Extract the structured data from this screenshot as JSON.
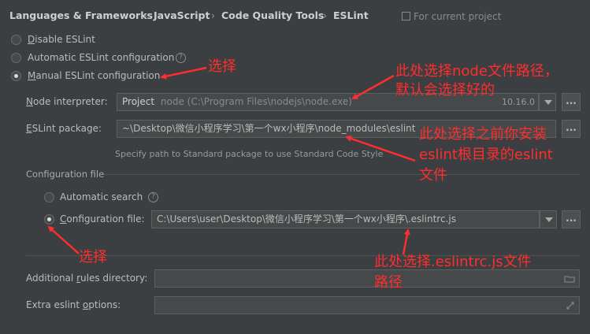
{
  "breadcrumb": {
    "items": [
      "Languages & Frameworks",
      "JavaScript",
      "Code Quality Tools",
      "ESLint"
    ],
    "separator": "›",
    "scope_label": "For current project"
  },
  "radios": {
    "disable": {
      "label": "Disable ESLint",
      "mnemonic": "D",
      "rest": "isable ESLint",
      "selected": false
    },
    "automatic": {
      "label": "Automatic ESLint configuration",
      "selected": false
    },
    "manual": {
      "label": "Manual ESLint configuration",
      "mnemonic": "M",
      "rest": "anual ESLint configuration",
      "selected": true
    }
  },
  "node_interpreter": {
    "label_mnemonic": "N",
    "label_rest": "ode interpreter:",
    "value_prefix": "Project",
    "value_path": "node (C:\\Program Files\\nodejs\\node.exe)",
    "version": "10.16.0",
    "browse": "..."
  },
  "eslint_package": {
    "label_mnemonic": "E",
    "label_rest": "SLint package:",
    "value": "~\\Desktop\\微信小程序学习\\第一个wx小程序\\node_modules\\eslint",
    "browse": "...",
    "hint": "Specify path to Standard package to use Standard Code Style"
  },
  "config_group": {
    "title": "Configuration file",
    "automatic_search": {
      "label": "Automatic search",
      "selected": false
    },
    "config_file": {
      "label_mnemonic": "C",
      "label_rest": "onfiguration file:",
      "value": "C:\\Users\\user\\Desktop\\微信小程序学习\\第一个wx小程序\\.eslintrc.js",
      "browse": "...",
      "selected": true
    }
  },
  "additional_rules": {
    "label_a": "Additional ",
    "label_mnemonic": "r",
    "label_b": "ules directory:"
  },
  "extra_options": {
    "label_a": "Extra eslint ",
    "label_mnemonic": "o",
    "label_b": "ptions:"
  },
  "annotations": {
    "a1": "选择",
    "a2_line1": "此处选择node文件路径，",
    "a2_line2": "默认会选择好的",
    "a3_line1": "此处选择之前你安装",
    "a3_line2": "eslint根目录的eslint",
    "a3_line3": "文件",
    "a4": "选择",
    "a5_line1": "此处选择.eslintrc.js文件",
    "a5_line2": "路径"
  },
  "colors": {
    "background": "#3c3f41",
    "field": "#45494a",
    "annotation": "#ff2d2d"
  }
}
